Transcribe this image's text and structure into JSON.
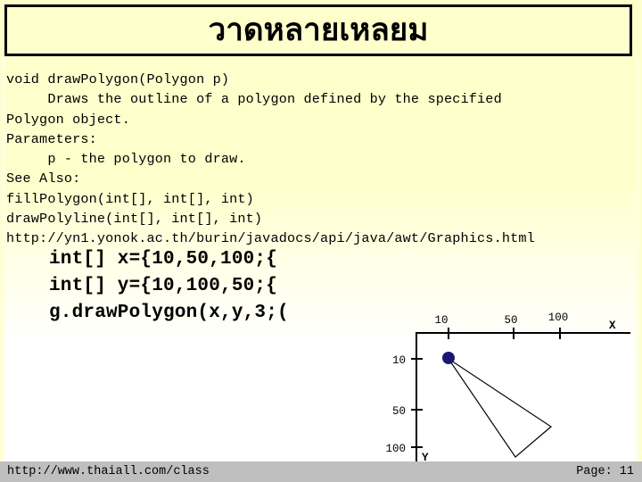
{
  "slide": {
    "title": "วาดหลายเหลยม",
    "title_bg": "#ffffcc",
    "title_border": "#000000",
    "background_top": "#ffffcc",
    "background_bottom": "#ffffff"
  },
  "javadoc": {
    "lines": [
      "void drawPolygon(Polygon p)",
      "     Draws the outline of a polygon defined by the specified",
      "Polygon object.",
      "Parameters:",
      "     p - the polygon to draw.",
      "See Also:",
      "fillPolygon(int[], int[], int)",
      "drawPolyline(int[], int[], int)",
      "http://yn1.yonok.ac.th/burin/javadocs/api/java/awt/Graphics.html"
    ]
  },
  "code_sample": {
    "lines": [
      "int[] x={10,50,100;{",
      "int[] y={10,100,50;{",
      "g.drawPolygon(x,y,3;("
    ]
  },
  "chart_data": {
    "type": "scatter",
    "title": "",
    "xlabel": "X",
    "ylabel": "Y",
    "x_ticks": [
      "10",
      "50",
      "100"
    ],
    "y_ticks": [
      "10",
      "50",
      "100"
    ],
    "x_tick_values": [
      10,
      50,
      100
    ],
    "y_tick_values": [
      10,
      50,
      100
    ],
    "xlim": [
      0,
      130
    ],
    "ylim": [
      0,
      130
    ],
    "grid": false,
    "legend": null,
    "y_axis_inverted": true,
    "series": [
      {
        "name": "polygon",
        "points": [
          {
            "x": 10,
            "y": 10
          },
          {
            "x": 100,
            "y": 50
          },
          {
            "x": 50,
            "y": 100
          }
        ],
        "closed": true,
        "line_color": "#000000"
      }
    ],
    "marker": {
      "name": "first-vertex",
      "x": 10,
      "y": 10,
      "color": "#191970",
      "radius": 7
    }
  },
  "footer": {
    "left": "http://www.thaiall.com/class",
    "right": "Page: 11",
    "bar_color": "#bfbfbf"
  }
}
